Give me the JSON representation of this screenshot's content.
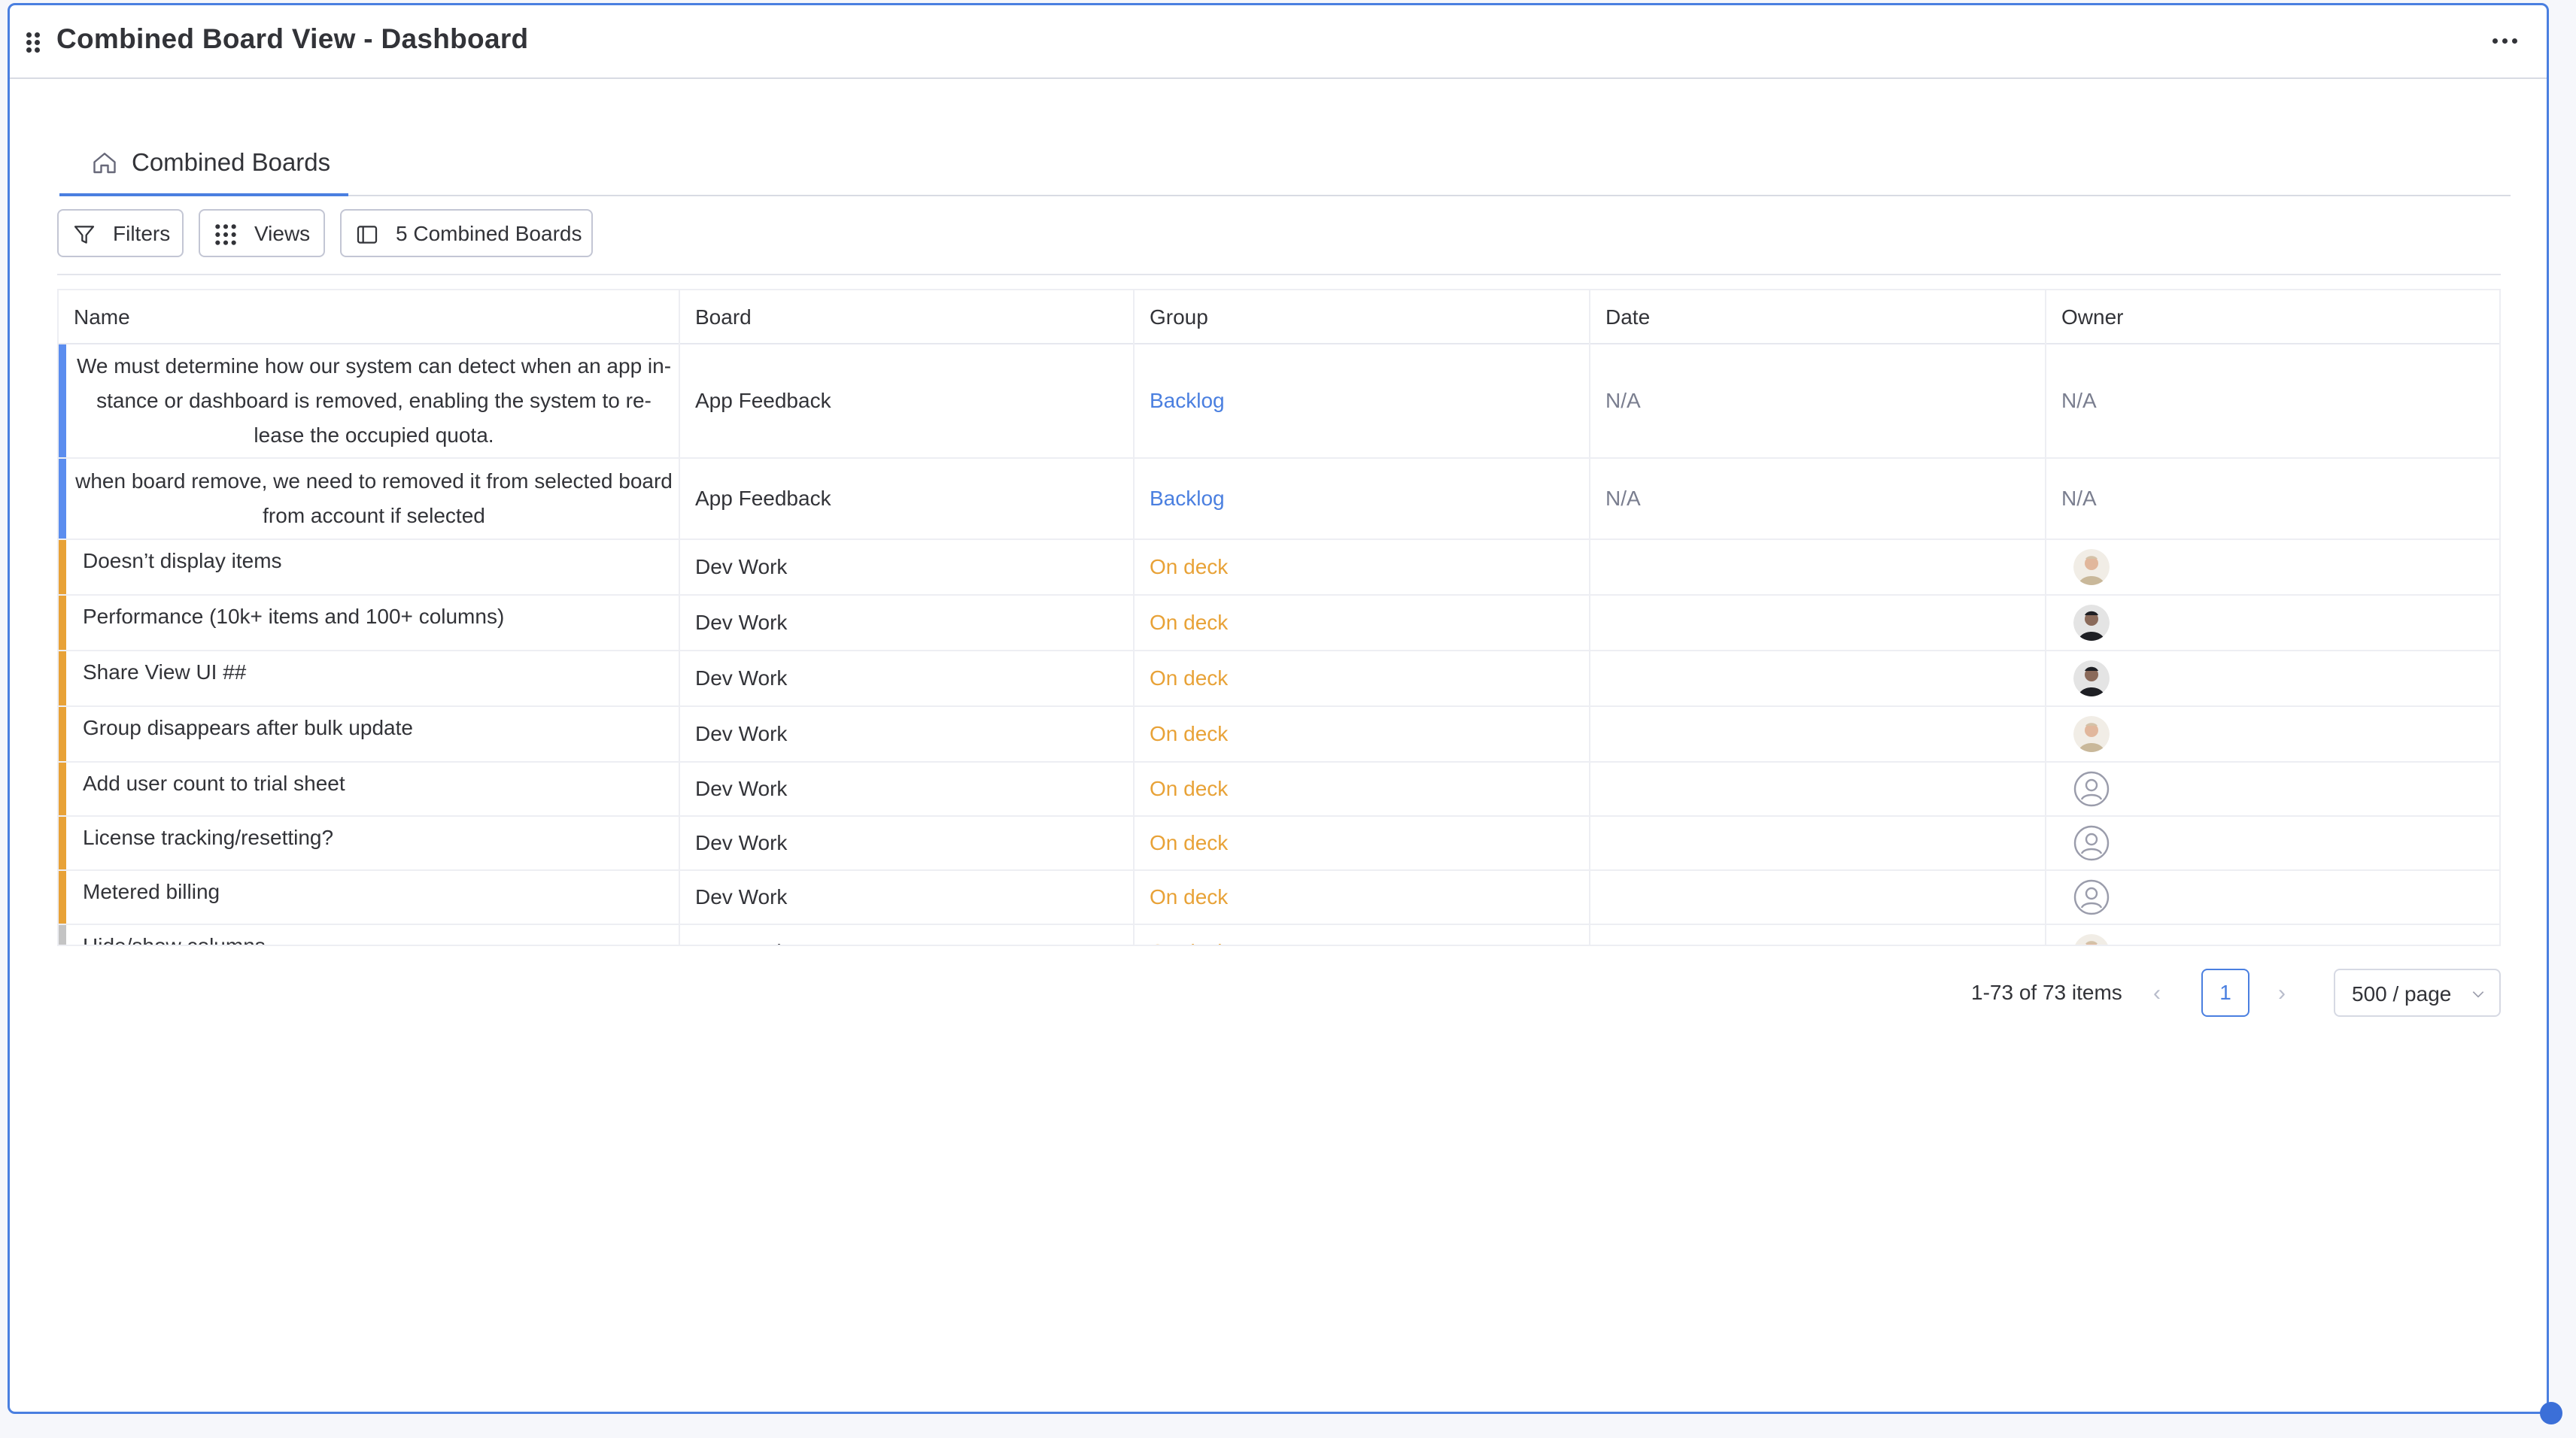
{
  "widget": {
    "title": "Combined Board View - Dashboard"
  },
  "tabs": [
    {
      "label": "Combined Boards",
      "icon": "home-icon",
      "active": true
    }
  ],
  "toolbar": {
    "filters_label": "Filters",
    "views_label": "Views",
    "combined_label": "5 Combined Boards"
  },
  "table": {
    "columns": [
      "Name",
      "Board",
      "Group",
      "Date",
      "Owner"
    ],
    "rows": [
      {
        "name": "We must determine how our system can detect when an app in-\nstance or dashboard is removed, enabling the system to re-\nlease the occupied quota.",
        "board": "App Feedback",
        "group": "Backlog",
        "date": "N/A",
        "owner": "N/A",
        "color": "#5b8def"
      },
      {
        "name": "when board remove, we need to removed it from selected board\nfrom account if selected",
        "board": "App Feedback",
        "group": "Backlog",
        "date": "N/A",
        "owner": "N/A",
        "color": "#5b8def"
      },
      {
        "name": "Doesn’t display items",
        "board": "Dev Work",
        "group": "On deck",
        "date": "",
        "owner": "avatar-a",
        "color": "#e8a237"
      },
      {
        "name": "Performance (10k+ items and 100+ columns)",
        "board": "Dev Work",
        "group": "On deck",
        "date": "",
        "owner": "avatar-b",
        "color": "#e8a237"
      },
      {
        "name": "Share View UI ##",
        "board": "Dev Work",
        "group": "On deck",
        "date": "",
        "owner": "avatar-b",
        "color": "#e8a237"
      },
      {
        "name": "Group disappears after bulk update",
        "board": "Dev Work",
        "group": "On deck",
        "date": "",
        "owner": "avatar-a",
        "color": "#e8a237"
      },
      {
        "name": "Add user count to trial sheet",
        "board": "Dev Work",
        "group": "On deck",
        "date": "",
        "owner": "empty",
        "color": "#e8a237"
      },
      {
        "name": "License tracking/resetting?",
        "board": "Dev Work",
        "group": "On deck",
        "date": "",
        "owner": "empty",
        "color": "#e8a237"
      },
      {
        "name": "Metered billing",
        "board": "Dev Work",
        "group": "On deck",
        "date": "",
        "owner": "empty",
        "color": "#e8a237"
      },
      {
        "name": "Hide/show columns",
        "board": "Dev Work",
        "group": "On deck",
        "date": "",
        "owner": "avatar-a",
        "color": "#c4c4c4"
      }
    ]
  },
  "pagination": {
    "summary": "1-73 of 73 items",
    "current_page": "1",
    "page_size": "500 / page"
  },
  "colors": {
    "accent": "#4a7fe0",
    "backlog": "#4a7fe0",
    "on_deck": "#e8a237"
  }
}
